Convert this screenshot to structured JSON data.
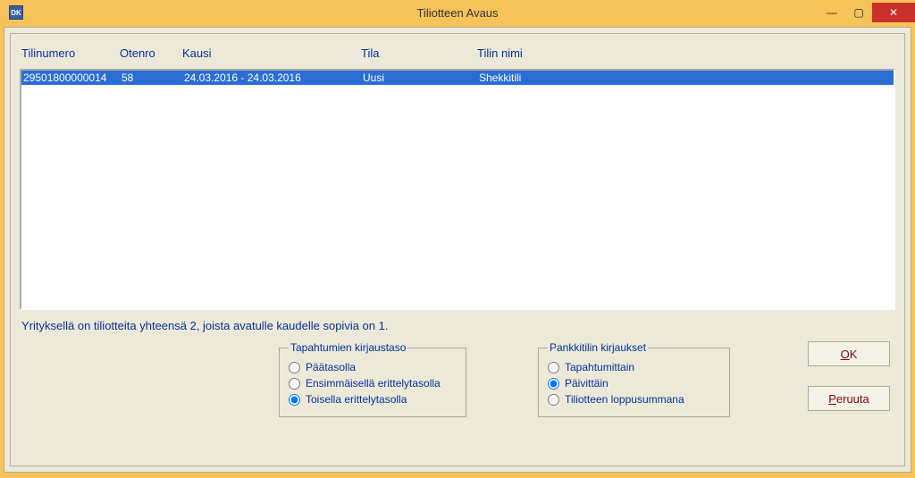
{
  "title": "Tiliotteen Avaus",
  "columns": {
    "tilinumero": "Tilinumero",
    "otenro": "Otenro",
    "kausi": "Kausi",
    "tila": "Tila",
    "nimi": "Tilin nimi"
  },
  "rows": [
    {
      "tilinumero": "29501800000014",
      "otenro": "58",
      "kausi": "24.03.2016 - 24.03.2016",
      "tila": "Uusi",
      "nimi": "Shekkitili"
    }
  ],
  "summary": "Yrityksellä on tiliotteita yhteensä 2, joista avatulle kaudelle sopivia on 1.",
  "group1": {
    "legend": "Tapahtumien kirjaustaso",
    "opt1": "Päätasolla",
    "opt2": "Ensimmäisellä erittelytasolla",
    "opt3": "Toisella erittelytasolla",
    "selected": 3
  },
  "group2": {
    "legend": "Pankkitilin kirjaukset",
    "opt1": "Tapahtumittain",
    "opt2": "Päivittäin",
    "opt3": "Tiliotteen loppusummana",
    "selected": 2
  },
  "buttons": {
    "ok_prefix": "O",
    "ok_rest": "K",
    "cancel_prefix": "P",
    "cancel_rest": "eruuta"
  },
  "win_icon": "DK",
  "win_controls": {
    "min": "—",
    "max": "▢",
    "close": "✕"
  }
}
